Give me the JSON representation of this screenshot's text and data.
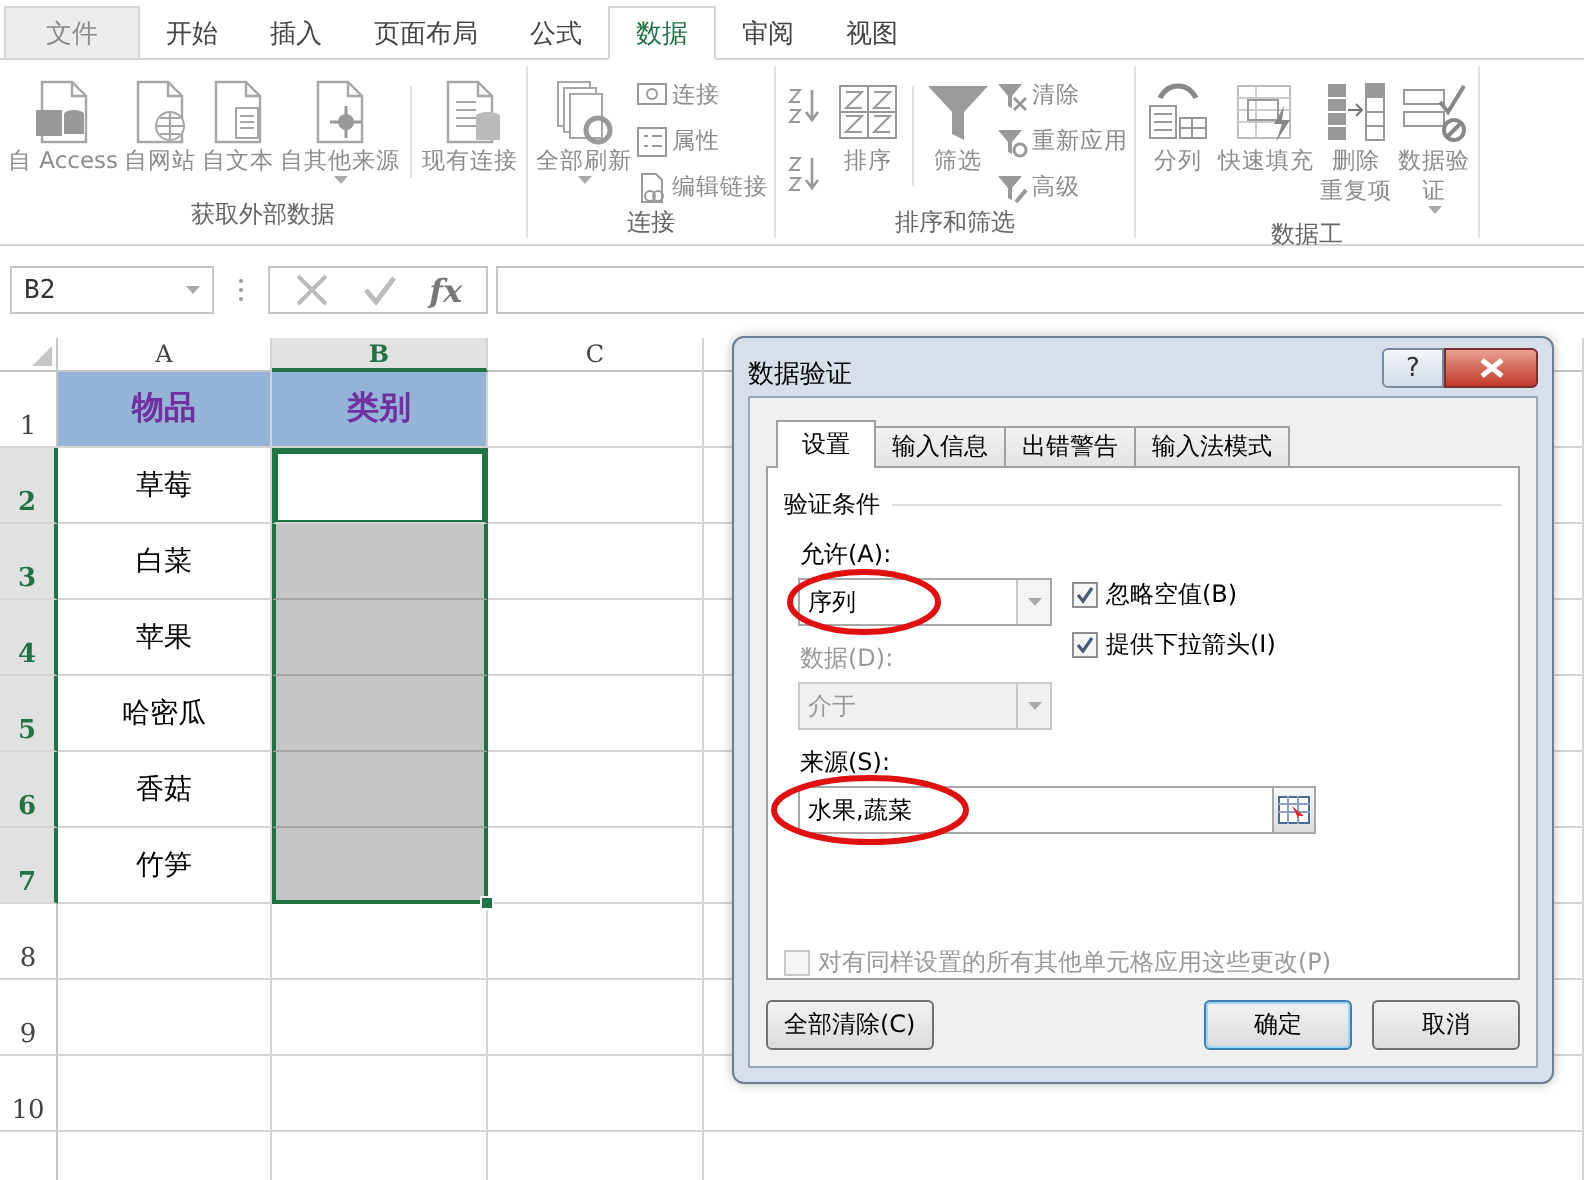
{
  "ribbon": {
    "tabs": [
      {
        "label": "文件",
        "kind": "file",
        "selected": false
      },
      {
        "label": "开始",
        "kind": "tab",
        "selected": false
      },
      {
        "label": "插入",
        "kind": "tab",
        "selected": false
      },
      {
        "label": "页面布局",
        "kind": "tab",
        "selected": false
      },
      {
        "label": "公式",
        "kind": "tab",
        "selected": false
      },
      {
        "label": "数据",
        "kind": "tab",
        "selected": true
      },
      {
        "label": "审阅",
        "kind": "tab",
        "selected": false
      },
      {
        "label": "视图",
        "kind": "tab",
        "selected": false
      }
    ],
    "groups": [
      {
        "label": "获取外部数据",
        "buttons": [
          {
            "kind": "large",
            "label": "自 Access"
          },
          {
            "kind": "large",
            "label": "自网站"
          },
          {
            "kind": "large",
            "label": "自文本"
          },
          {
            "kind": "large",
            "label": "自其他来源",
            "caret": true
          },
          {
            "kind": "separator"
          },
          {
            "kind": "large",
            "label": "现有连接"
          }
        ]
      },
      {
        "label": "连接",
        "buttons": [
          {
            "kind": "large",
            "label": "全部刷新",
            "caret": true
          },
          {
            "kind": "small-stack",
            "items": [
              {
                "label": "连接"
              },
              {
                "label": "属性"
              },
              {
                "label": "编辑链接"
              }
            ]
          }
        ]
      },
      {
        "label": "排序和筛选",
        "buttons": [
          {
            "kind": "sort-pair"
          },
          {
            "kind": "large",
            "label": "排序"
          },
          {
            "kind": "separator"
          },
          {
            "kind": "large",
            "label": "筛选"
          },
          {
            "kind": "small-stack",
            "items": [
              {
                "label": "清除"
              },
              {
                "label": "重新应用"
              },
              {
                "label": "高级"
              }
            ]
          }
        ]
      },
      {
        "label": "数据工",
        "buttons": [
          {
            "kind": "large",
            "label": "分列"
          },
          {
            "kind": "large",
            "label": "快速填充"
          },
          {
            "kind": "large",
            "lines": [
              "删除",
              "重复项"
            ]
          },
          {
            "kind": "large",
            "lines": [
              "数据验",
              "证"
            ],
            "caret": true
          }
        ]
      }
    ]
  },
  "formula_bar": {
    "name_box": "B2",
    "function_label": "fx"
  },
  "sheet": {
    "columns": [
      {
        "label": "A",
        "selected": false
      },
      {
        "label": "B",
        "selected": true
      },
      {
        "label": "C",
        "selected": false
      }
    ],
    "rows": [
      {
        "label": "1",
        "selected": false,
        "kind": "header",
        "cells": [
          {
            "text": "物品",
            "selected": false
          },
          {
            "text": "类别",
            "selected": false,
            "active": false
          }
        ]
      },
      {
        "label": "2",
        "selected": true,
        "kind": "data",
        "cells": [
          {
            "text": "草莓",
            "selected": false
          },
          {
            "selected": true,
            "active": true
          }
        ]
      },
      {
        "label": "3",
        "selected": true,
        "kind": "data",
        "cells": [
          {
            "text": "白菜",
            "selected": false
          },
          {
            "selected": true,
            "active": false
          }
        ]
      },
      {
        "label": "4",
        "selected": true,
        "kind": "data",
        "cells": [
          {
            "text": "苹果",
            "selected": false
          },
          {
            "selected": true,
            "active": false
          }
        ]
      },
      {
        "label": "5",
        "selected": true,
        "kind": "data",
        "cells": [
          {
            "text": "哈密瓜",
            "selected": false
          },
          {
            "selected": true,
            "active": false
          }
        ]
      },
      {
        "label": "6",
        "selected": true,
        "kind": "data",
        "cells": [
          {
            "text": "香菇",
            "selected": false
          },
          {
            "selected": true,
            "active": false
          }
        ]
      },
      {
        "label": "7",
        "selected": true,
        "kind": "data",
        "cells": [
          {
            "text": "竹笋",
            "selected": false
          },
          {
            "selected": true,
            "active": false
          }
        ]
      },
      {
        "label": "8",
        "selected": false,
        "cells": []
      },
      {
        "label": "9",
        "selected": false,
        "cells": []
      },
      {
        "label": "10",
        "selected": false,
        "cells": []
      }
    ]
  },
  "dialog": {
    "title": "数据验证",
    "help": "?",
    "tabs": [
      {
        "label": "设置",
        "selected": true
      },
      {
        "label": "输入信息",
        "selected": false
      },
      {
        "label": "出错警告",
        "selected": false
      },
      {
        "label": "输入法模式",
        "selected": false
      }
    ],
    "section": "验证条件",
    "allow": {
      "label": "允许(A):",
      "value": "序列",
      "circled": true
    },
    "options": [
      {
        "label": "忽略空值(B)",
        "checked": true
      },
      {
        "label": "提供下拉箭头(I)",
        "checked": true
      }
    ],
    "data": {
      "label": "数据(D):",
      "value": "介于",
      "disabled": true
    },
    "source": {
      "label": "来源(S):",
      "value": "水果,蔬菜",
      "circled": true
    },
    "apply_all": {
      "label": "对有同样设置的所有其他单元格应用这些更改(P)",
      "checked": false,
      "disabled": true
    },
    "buttons": [
      {
        "label": "全部清除(C)",
        "kind": "clear"
      },
      {
        "label": "确定",
        "kind": "default"
      },
      {
        "label": "取消",
        "kind": "cancel"
      }
    ]
  }
}
